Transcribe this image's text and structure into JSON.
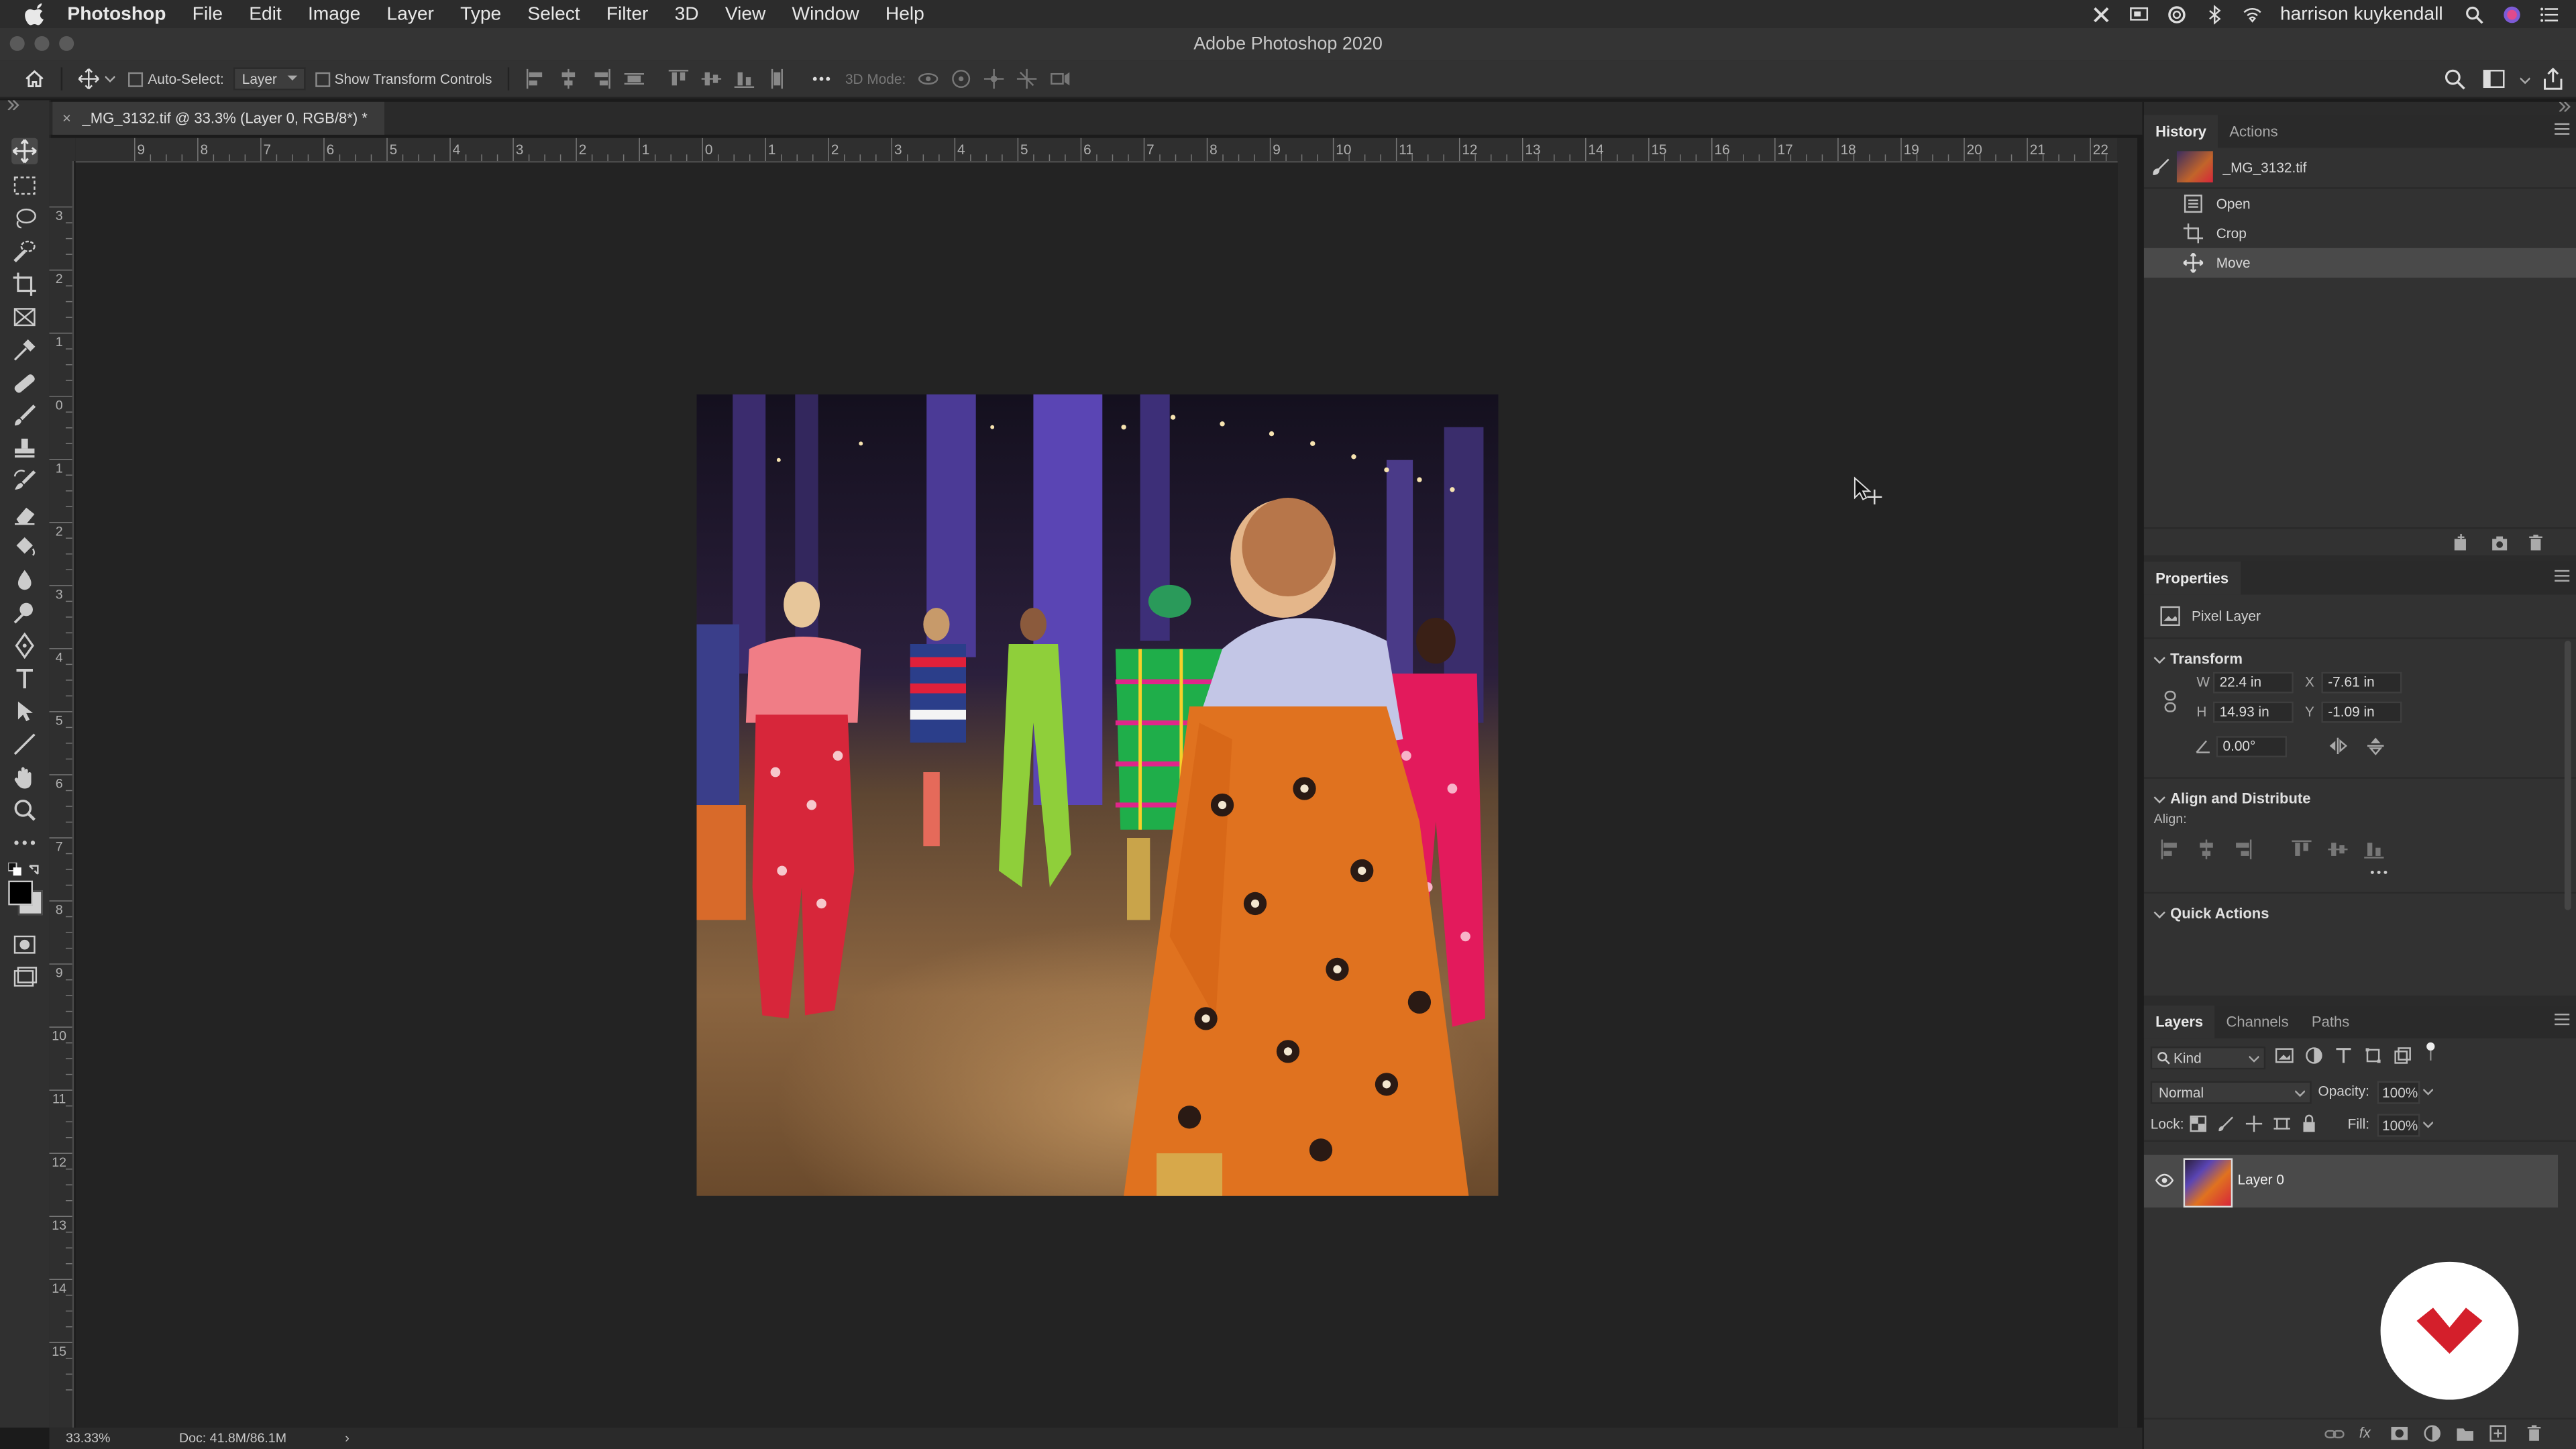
{
  "menubar": {
    "app": "Photoshop",
    "items": [
      "File",
      "Edit",
      "Image",
      "Layer",
      "Type",
      "Select",
      "Filter",
      "3D",
      "View",
      "Window",
      "Help"
    ],
    "user": "harrison kuykendall"
  },
  "window": {
    "title": "Adobe Photoshop 2020"
  },
  "options": {
    "auto_select_label": "Auto-Select:",
    "auto_select_value": "Layer",
    "transform_controls_label": "Show Transform Controls",
    "mode_3d_label": "3D Mode:"
  },
  "document": {
    "tab_title": "_MG_3132.tif @ 33.3% (Layer 0, RGB/8*) *",
    "zoom": "33.33%",
    "doc_size": "Doc: 41.8M/86.1M",
    "ruler_top": [
      "9",
      "8",
      "7",
      "6",
      "5",
      "4",
      "3",
      "2",
      "1",
      "0",
      "1",
      "2",
      "3",
      "4",
      "5",
      "6",
      "7",
      "8",
      "9",
      "10",
      "11",
      "12",
      "13",
      "14",
      "15",
      "16",
      "17",
      "18",
      "19",
      "20",
      "21",
      "22"
    ],
    "ruler_left": [
      "3",
      "2",
      "1",
      "0",
      "1",
      "2",
      "3",
      "4",
      "5",
      "6",
      "7",
      "8",
      "9",
      "10",
      "11",
      "12",
      "13",
      "14",
      "15"
    ]
  },
  "history": {
    "tabs": [
      "History",
      "Actions"
    ],
    "snapshot": "_MG_3132.tif",
    "items": [
      "Open",
      "Crop",
      "Move"
    ]
  },
  "properties": {
    "title": "Properties",
    "type": "Pixel Layer",
    "transform_label": "Transform",
    "w": "22.4 in",
    "x": "-7.61 in",
    "h": "14.93 in",
    "y": "-1.09 in",
    "angle": "0.00°",
    "align_label": "Align and Distribute",
    "align_sub": "Align:",
    "quick_actions": "Quick Actions",
    "w_lbl": "W",
    "h_lbl": "H",
    "x_lbl": "X",
    "y_lbl": "Y"
  },
  "layers": {
    "tabs": [
      "Layers",
      "Channels",
      "Paths"
    ],
    "kind": "Kind",
    "blend": "Normal",
    "opacity_label": "Opacity:",
    "opacity": "100%",
    "lock_label": "Lock:",
    "fill_label": "Fill:",
    "fill": "100%",
    "layer_name": "Layer 0"
  },
  "colors": {
    "accent": "#d41f2b"
  }
}
